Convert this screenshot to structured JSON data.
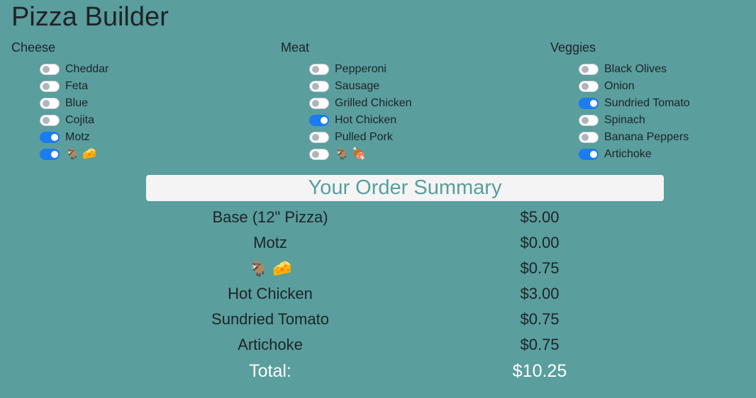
{
  "page_title": "Pizza Builder",
  "colors": {
    "background": "#5a9e9e",
    "toggle_on": "#1a7cf2",
    "banner_background": "#f4f4f4",
    "banner_text": "#5a9e9e"
  },
  "columns": [
    {
      "heading": "Cheese",
      "options": [
        {
          "label": "Cheddar",
          "checked": false
        },
        {
          "label": "Feta",
          "checked": false
        },
        {
          "label": "Blue",
          "checked": false
        },
        {
          "label": "Cojita",
          "checked": false
        },
        {
          "label": "Motz",
          "checked": true
        },
        {
          "label": "🐐 🧀",
          "checked": true
        }
      ]
    },
    {
      "heading": "Meat",
      "options": [
        {
          "label": "Pepperoni",
          "checked": false
        },
        {
          "label": "Sausage",
          "checked": false
        },
        {
          "label": "Grilled Chicken",
          "checked": false
        },
        {
          "label": "Hot Chicken",
          "checked": true
        },
        {
          "label": "Pulled Pork",
          "checked": false
        },
        {
          "label": "🐐 🍖",
          "checked": false
        }
      ]
    },
    {
      "heading": "Veggies",
      "options": [
        {
          "label": "Black Olives",
          "checked": false
        },
        {
          "label": "Onion",
          "checked": false
        },
        {
          "label": "Sundried Tomato",
          "checked": true
        },
        {
          "label": "Spinach",
          "checked": false
        },
        {
          "label": "Banana Peppers",
          "checked": false
        },
        {
          "label": "Artichoke",
          "checked": true
        }
      ]
    }
  ],
  "summary": {
    "heading": "Your Order Summary",
    "items": [
      {
        "name": "Base (12\" Pizza)",
        "price": "$5.00"
      },
      {
        "name": "Motz",
        "price": "$0.00"
      },
      {
        "name": "🐐 🧀",
        "price": "$0.75"
      },
      {
        "name": "Hot Chicken",
        "price": "$3.00"
      },
      {
        "name": "Sundried Tomato",
        "price": "$0.75"
      },
      {
        "name": "Artichoke",
        "price": "$0.75"
      }
    ],
    "total_label": "Total:",
    "total_value": "$10.25"
  }
}
